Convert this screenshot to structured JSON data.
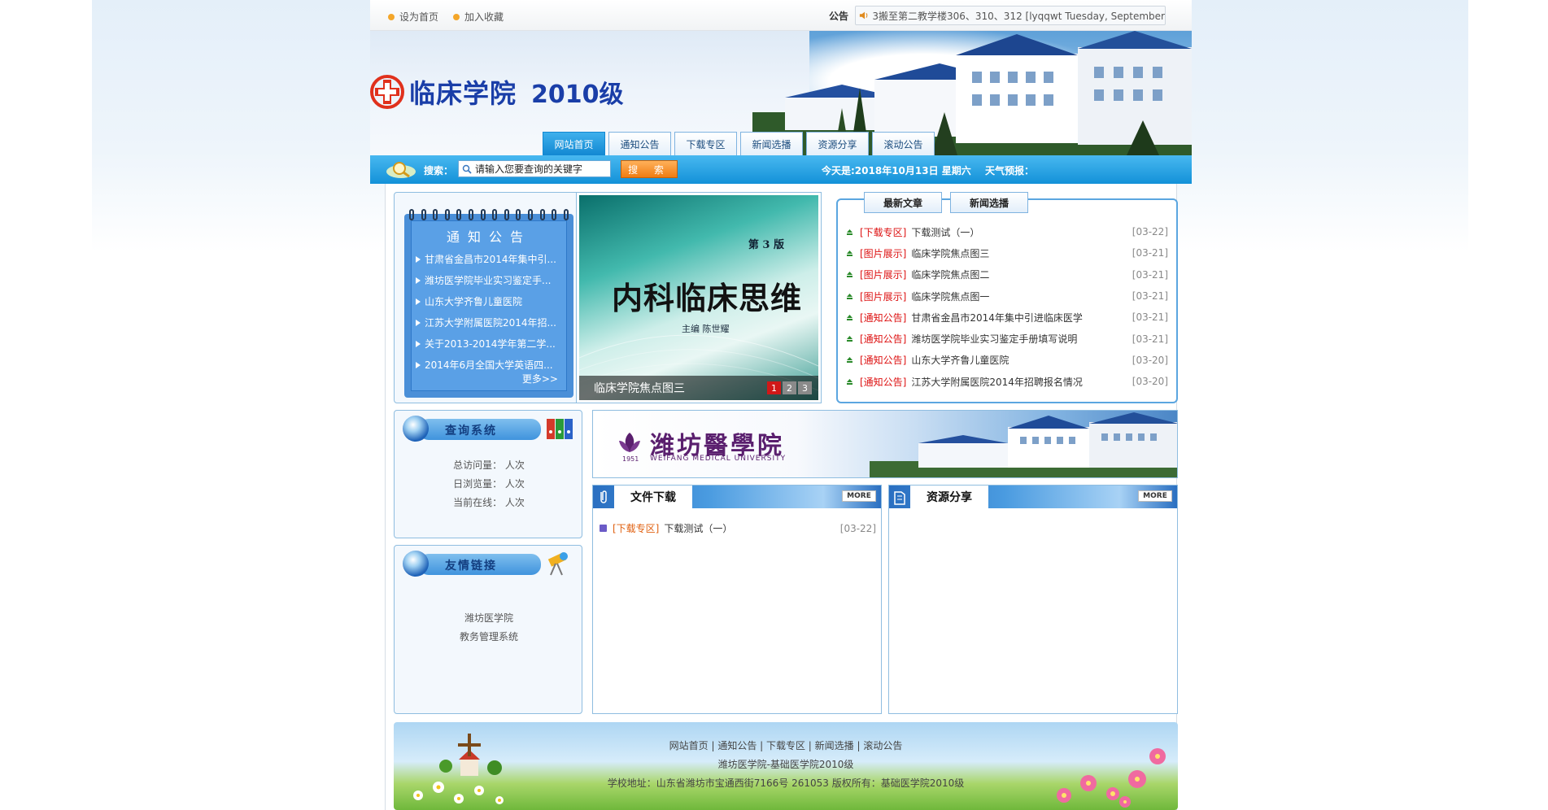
{
  "topbar": {
    "set_home": "设为首页",
    "add_fav": "加入收藏",
    "notice_label": "公告",
    "notice_text": "3搬至第二教学楼306、310、312 [lyqqwt  Tuesday, September"
  },
  "site": {
    "title": "临床学院",
    "year": "2010级"
  },
  "nav": {
    "tabs": [
      "网站首页",
      "通知公告",
      "下载专区",
      "新闻选播",
      "资源分享",
      "滚动公告"
    ]
  },
  "search": {
    "label": "搜索：",
    "placeholder": "请输入您要查询的关键字",
    "button": "搜 索",
    "date": "今天是:2018年10月13日 星期六",
    "weather": "天气预报："
  },
  "notice_board": {
    "title": "通知公告",
    "items": [
      "甘肃省金昌市2014年集中引...",
      "潍坊医学院毕业实习鉴定手...",
      "山东大学齐鲁儿童医院",
      "江苏大学附属医院2014年招...",
      "关于2013-2014学年第二学...",
      "2014年6月全国大学英语四..."
    ],
    "more": "更多>>"
  },
  "slideshow": {
    "edition": "第 3 版",
    "book_title": "内科临床思维",
    "author": "主编  陈世耀",
    "caption": "临床学院焦点图三",
    "pages": [
      "1",
      "2",
      "3"
    ],
    "active_page": 1
  },
  "latest": {
    "tabs": [
      "最新文章",
      "新闻选播"
    ],
    "items": [
      {
        "cat": "[下载专区]",
        "title": "下载测试（一）",
        "date": "[03-22]"
      },
      {
        "cat": "[图片展示]",
        "title": "临床学院焦点图三",
        "date": "[03-21]"
      },
      {
        "cat": "[图片展示]",
        "title": "临床学院焦点图二",
        "date": "[03-21]"
      },
      {
        "cat": "[图片展示]",
        "title": "临床学院焦点图一",
        "date": "[03-21]"
      },
      {
        "cat": "[通知公告]",
        "title": "甘肃省金昌市2014年集中引进临床医学",
        "date": "[03-21]"
      },
      {
        "cat": "[通知公告]",
        "title": "潍坊医学院毕业实习鉴定手册填写说明",
        "date": "[03-21]"
      },
      {
        "cat": "[通知公告]",
        "title": "山东大学齐鲁儿童医院",
        "date": "[03-20]"
      },
      {
        "cat": "[通知公告]",
        "title": "江苏大学附属医院2014年招聘报名情况",
        "date": "[03-20]"
      }
    ]
  },
  "query": {
    "title": "查询系统",
    "total_visits": "总访问量： 人次",
    "daily_views": "日浏览量： 人次",
    "online": "当前在线： 人次"
  },
  "friend_links": {
    "title": "友情链接",
    "items": [
      "潍坊医学院",
      "教务管理系统"
    ]
  },
  "weifang_banner": {
    "name": "潍坊醫學院",
    "english": "WEIFANG MEDICAL UNIVERSITY",
    "year": "1951"
  },
  "downloads": {
    "title": "文件下载",
    "more": "MORE",
    "items": [
      {
        "cat": "[下载专区]",
        "title": "下载测试（一）",
        "date": "[03-22]"
      }
    ]
  },
  "resources": {
    "title": "资源分享",
    "more": "MORE"
  },
  "footer": {
    "links": "网站首页 | 通知公告 | 下载专区 | 新闻选播 | 滚动公告",
    "org": "潍坊医学院-基础医学院2010级",
    "address": "学校地址：山东省潍坊市宝通西街7166号 261053  版权所有：基础医学院2010级"
  },
  "colors": {
    "accent": "#1391d8",
    "title_blue": "#1a3ea8",
    "category_red": "#dd1111"
  }
}
